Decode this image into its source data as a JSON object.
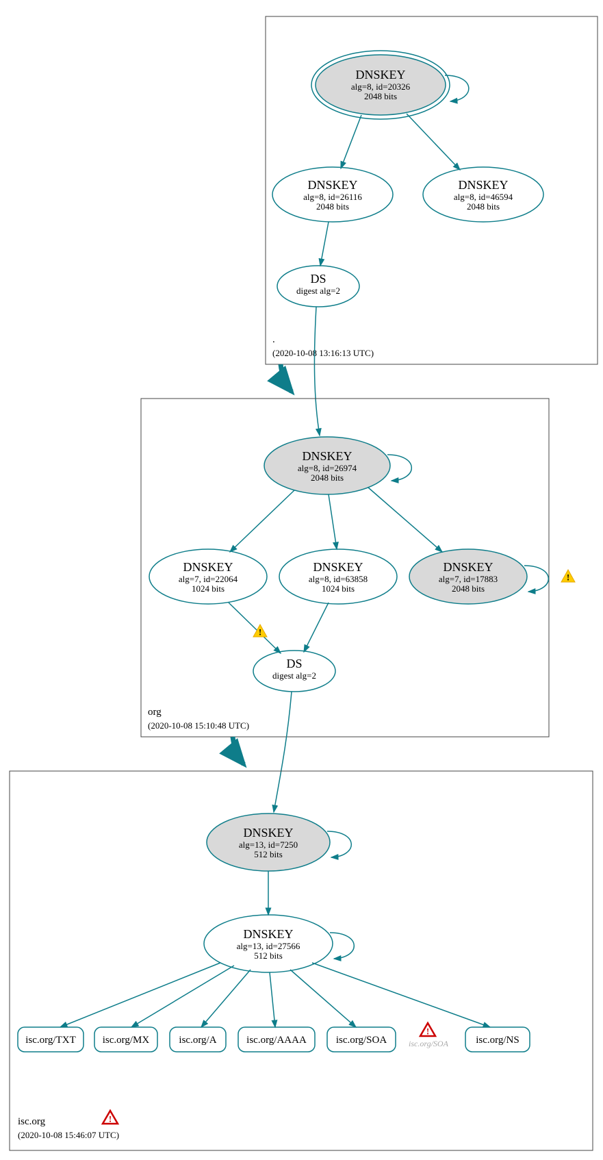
{
  "zones": {
    "root": {
      "label": ".",
      "ts": "(2020-10-08 13:16:13 UTC)"
    },
    "org": {
      "label": "org",
      "ts": "(2020-10-08 15:10:48 UTC)"
    },
    "isc": {
      "label": "isc.org",
      "ts": "(2020-10-08 15:46:07 UTC)"
    }
  },
  "nodes": {
    "root_ksk": {
      "t": "DNSKEY",
      "s1": "alg=8, id=20326",
      "s2": "2048 bits"
    },
    "root_zsk1": {
      "t": "DNSKEY",
      "s1": "alg=8, id=26116",
      "s2": "2048 bits"
    },
    "root_zsk2": {
      "t": "DNSKEY",
      "s1": "alg=8, id=46594",
      "s2": "2048 bits"
    },
    "root_ds": {
      "t": "DS",
      "s1": "digest alg=2",
      "s2": ""
    },
    "org_ksk": {
      "t": "DNSKEY",
      "s1": "alg=8, id=26974",
      "s2": "2048 bits"
    },
    "org_k1": {
      "t": "DNSKEY",
      "s1": "alg=7, id=22064",
      "s2": "1024 bits"
    },
    "org_k2": {
      "t": "DNSKEY",
      "s1": "alg=8, id=63858",
      "s2": "1024 bits"
    },
    "org_k3": {
      "t": "DNSKEY",
      "s1": "alg=7, id=17883",
      "s2": "2048 bits"
    },
    "org_ds": {
      "t": "DS",
      "s1": "digest alg=2",
      "s2": ""
    },
    "isc_ksk": {
      "t": "DNSKEY",
      "s1": "alg=13, id=7250",
      "s2": "512 bits"
    },
    "isc_zsk": {
      "t": "DNSKEY",
      "s1": "alg=13, id=27566",
      "s2": "512 bits"
    }
  },
  "rr": {
    "txt": "isc.org/TXT",
    "mx": "isc.org/MX",
    "a": "isc.org/A",
    "aaaa": "isc.org/AAAA",
    "soa": "isc.org/SOA",
    "soa2": "isc.org/SOA",
    "ns": "isc.org/NS"
  }
}
